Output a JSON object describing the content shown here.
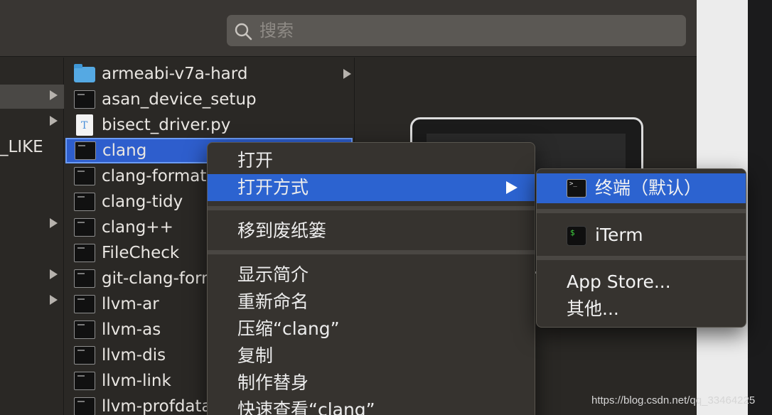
{
  "search": {
    "placeholder": "搜索"
  },
  "sidebar": {
    "partial_label": "_LIKE"
  },
  "files": [
    {
      "name": "armeabi-v7a-hard",
      "icon": "folder-icon",
      "has_children": true
    },
    {
      "name": "asan_device_setup",
      "icon": "executable-icon"
    },
    {
      "name": "bisect_driver.py",
      "icon": "python-script-icon"
    },
    {
      "name": "clang",
      "icon": "executable-icon",
      "selected": true
    },
    {
      "name": "clang-format",
      "icon": "executable-icon"
    },
    {
      "name": "clang-tidy",
      "icon": "executable-icon"
    },
    {
      "name": "clang++",
      "icon": "executable-icon"
    },
    {
      "name": "FileCheck",
      "icon": "executable-icon"
    },
    {
      "name": "git-clang-format",
      "icon": "executable-icon"
    },
    {
      "name": "llvm-ar",
      "icon": "executable-icon"
    },
    {
      "name": "llvm-as",
      "icon": "executable-icon"
    },
    {
      "name": "llvm-dis",
      "icon": "executable-icon"
    },
    {
      "name": "llvm-link",
      "icon": "executable-icon"
    },
    {
      "name": "llvm-profdata",
      "icon": "executable-icon"
    }
  ],
  "context_menu": {
    "open": "打开",
    "open_with": "打开方式",
    "move_to_trash": "移到废纸篓",
    "get_info": "显示简介",
    "rename": "重新命名",
    "compress": "压缩“clang”",
    "duplicate": "复制",
    "make_alias": "制作替身",
    "quick_look": "快速查看“clang”"
  },
  "submenu": {
    "terminal_default": "终端（默认）",
    "iterm": "iTerm",
    "app_store": "App Store...",
    "other": "其他..."
  },
  "watermark": "https://blog.csdn.net/qq_33464225",
  "colors": {
    "selection_blue": "#2e5ecd",
    "menu_highlight": "#2c63d0",
    "menu_bg": "#36332f"
  }
}
